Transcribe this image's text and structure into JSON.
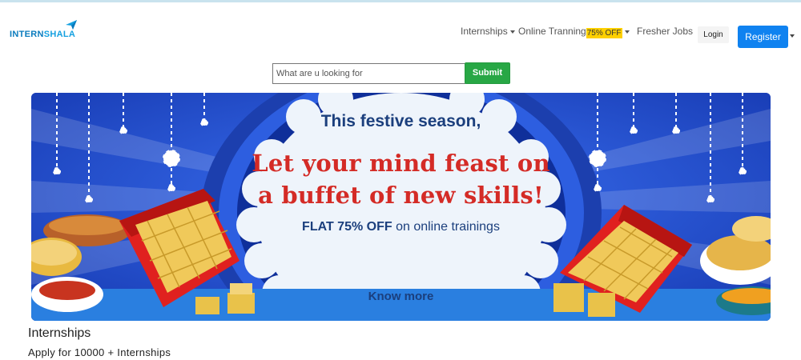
{
  "brand": {
    "logo_text_part1": "INTERN",
    "logo_text_part2": "SHALA",
    "logo_color": "#0a7bbd",
    "plane_icon": "paper-plane-icon"
  },
  "nav": {
    "internships": "Internships",
    "online_training": "Online Tranning",
    "online_training_badge": "75% OFF",
    "fresher_jobs": "Fresher Jobs",
    "login": "Login",
    "register": "Register"
  },
  "search": {
    "placeholder": "What are u looking for",
    "value": "",
    "submit_label": "Submit"
  },
  "banner": {
    "headline": "This festive season,",
    "tagline_line1": "Let your mind feast on",
    "tagline_line2": "a buffet of new skills!",
    "offer_bold": "FLAT 75% OFF",
    "offer_rest": " on online trainings",
    "cta": "Know more",
    "colors": {
      "background": "#1f49c9",
      "tagline": "#d42b26",
      "headline": "#1b3f7d",
      "sweet_box": "#e0211f",
      "sweet": "#f0c95a"
    }
  },
  "section": {
    "title": "Internships",
    "subtitle": "Apply for 10000 + Internships"
  },
  "colors": {
    "register_button": "#0f82f0",
    "submit_button": "#28a745",
    "badge": "#ffd000"
  }
}
